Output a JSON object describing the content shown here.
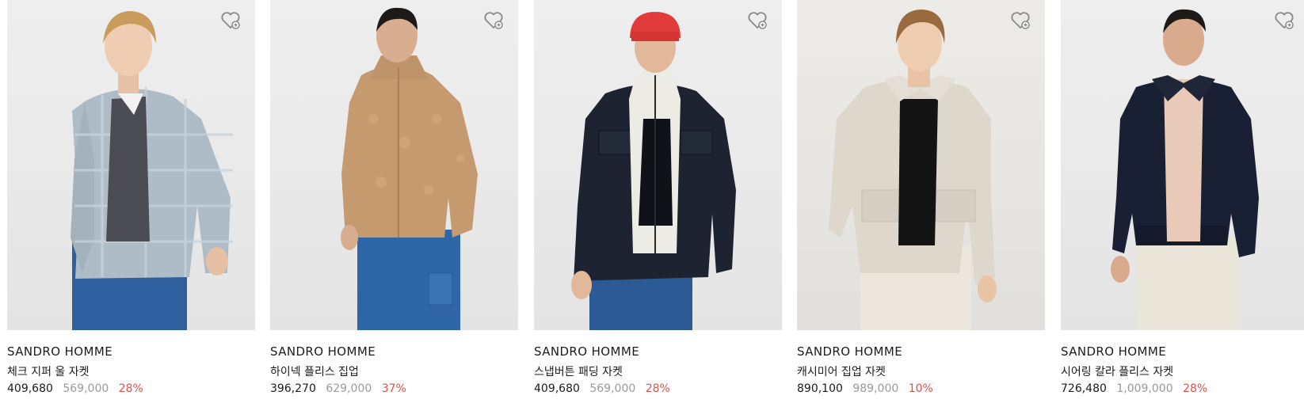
{
  "products": [
    {
      "brand": "SANDRO HOMME",
      "name": "체크 지퍼 울 자켓",
      "price": "409,680",
      "original_price": "569,000",
      "discount": "28%",
      "favorite_icon": "heart-outline-icon"
    },
    {
      "brand": "SANDRO HOMME",
      "name": "하이넥 플리스 집업",
      "price": "396,270",
      "original_price": "629,000",
      "discount": "37%",
      "favorite_icon": "heart-outline-icon"
    },
    {
      "brand": "SANDRO HOMME",
      "name": "스냅버튼 패딩 자켓",
      "price": "409,680",
      "original_price": "569,000",
      "discount": "28%",
      "favorite_icon": "heart-outline-icon"
    },
    {
      "brand": "SANDRO HOMME",
      "name": "캐시미어 집업 자켓",
      "price": "890,100",
      "original_price": "989,000",
      "discount": "10%",
      "favorite_icon": "heart-outline-icon"
    },
    {
      "brand": "SANDRO HOMME",
      "name": "시어링 칼라 플리스 자켓",
      "price": "726,480",
      "original_price": "1,009,000",
      "discount": "28%",
      "favorite_icon": "heart-outline-icon"
    }
  ],
  "colors": {
    "discount": "#d9534f",
    "original_price": "#9a9a9a",
    "text": "#1b1b1b"
  }
}
